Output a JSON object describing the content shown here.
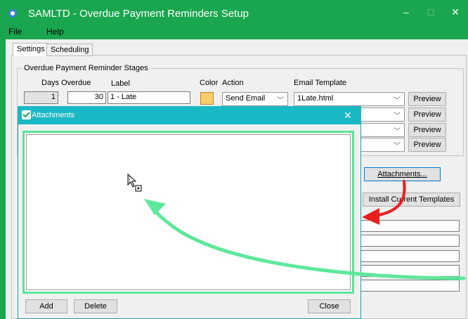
{
  "window": {
    "title": "SAMLTD - Overdue Payment Reminders Setup",
    "minimize": "–",
    "maximize": "□",
    "close": "✕",
    "titlebar_color": "#19a64e"
  },
  "menu": {
    "file": "File",
    "help": "Help"
  },
  "tabs": [
    {
      "label": "Settings"
    },
    {
      "label": "Scheduling"
    }
  ],
  "stages": {
    "group_label": "Overdue Payment Reminder Stages",
    "headers": {
      "days_overdue": "Days Overdue",
      "label": "Label",
      "color": "Color",
      "action": "Action",
      "email_template": "Email Template"
    },
    "row1": {
      "from_days": "1",
      "to_days": "30",
      "label": "1 - Late",
      "color": "#f7cc6a",
      "action": "Send Email",
      "template": "1Late.html"
    },
    "preview_label": "Preview"
  },
  "buttons": {
    "attachments": "Attachments...",
    "install_templates": "Install Current Templates"
  },
  "dialog": {
    "title": "Attachments",
    "close_x": "✕",
    "add": "Add",
    "delete": "Delete",
    "close": "Close",
    "accent": "#1ab8c4"
  },
  "annotations": {
    "red_arrow_color": "#e8201f",
    "green_arrow_color": "#5ee89a"
  }
}
